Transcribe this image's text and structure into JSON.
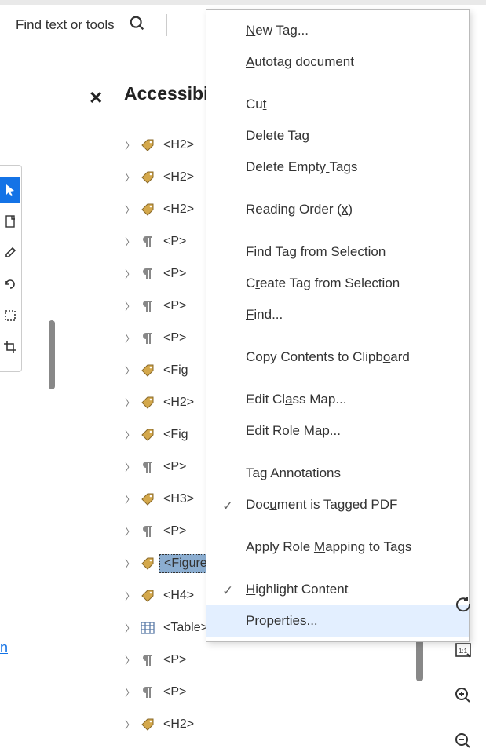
{
  "search": {
    "placeholder": "Find text or tools"
  },
  "panel": {
    "title": "Accessibility tags",
    "title_clipped": "Accessibi"
  },
  "tags": [
    {
      "type": "tag",
      "label": "<H2>"
    },
    {
      "type": "tag",
      "label": "<H2>"
    },
    {
      "type": "tag",
      "label": "<H2>"
    },
    {
      "type": "para",
      "label": "<P>"
    },
    {
      "type": "para",
      "label": "<P>"
    },
    {
      "type": "para",
      "label": "<P>"
    },
    {
      "type": "para",
      "label": "<P>"
    },
    {
      "type": "tag",
      "label": "<Figure>",
      "clipped": "<Fig"
    },
    {
      "type": "tag",
      "label": "<H2>"
    },
    {
      "type": "tag",
      "label": "<Figure>",
      "clipped": "<Fig"
    },
    {
      "type": "para",
      "label": "<P>"
    },
    {
      "type": "tag",
      "label": "<H3>"
    },
    {
      "type": "para",
      "label": "<P>"
    },
    {
      "type": "tag",
      "label": "<Figure>",
      "selected": true
    },
    {
      "type": "tag",
      "label": "<H4>"
    },
    {
      "type": "table",
      "label": "<Table>"
    },
    {
      "type": "para",
      "label": "<P>"
    },
    {
      "type": "para",
      "label": "<P>"
    },
    {
      "type": "tag",
      "label": "<H2>"
    }
  ],
  "menu": [
    {
      "label": "New Tag...",
      "u": 0
    },
    {
      "label": "Autotag document",
      "u": 0
    },
    {
      "gap": true
    },
    {
      "label": "Cut",
      "u": 2
    },
    {
      "label": "Delete Tag",
      "u": 0
    },
    {
      "label": "Delete Empty Tags",
      "u": 12
    },
    {
      "gap": true
    },
    {
      "label": "Reading Order (x)",
      "u": 15
    },
    {
      "gap": true
    },
    {
      "label": "Find Tag from Selection",
      "u": 1
    },
    {
      "label": "Create Tag from Selection",
      "u": 1
    },
    {
      "label": "Find...",
      "u": 0
    },
    {
      "gap": true
    },
    {
      "label": "Copy Contents to Clipboard",
      "u": 22
    },
    {
      "gap": true
    },
    {
      "label": "Edit Class Map...",
      "u": 7
    },
    {
      "label": "Edit Role Map...",
      "u": 6
    },
    {
      "gap": true
    },
    {
      "label": "Tag Annotations"
    },
    {
      "label": "Document is Tagged PDF",
      "u": 3,
      "check": true
    },
    {
      "gap": true
    },
    {
      "label": "Apply Role Mapping to Tags",
      "u": 11
    },
    {
      "gap": true
    },
    {
      "label": "Highlight Content",
      "u": 0,
      "check": true
    },
    {
      "label": "Properties...",
      "u": 0,
      "hover": true
    }
  ],
  "link_fragment": "n"
}
